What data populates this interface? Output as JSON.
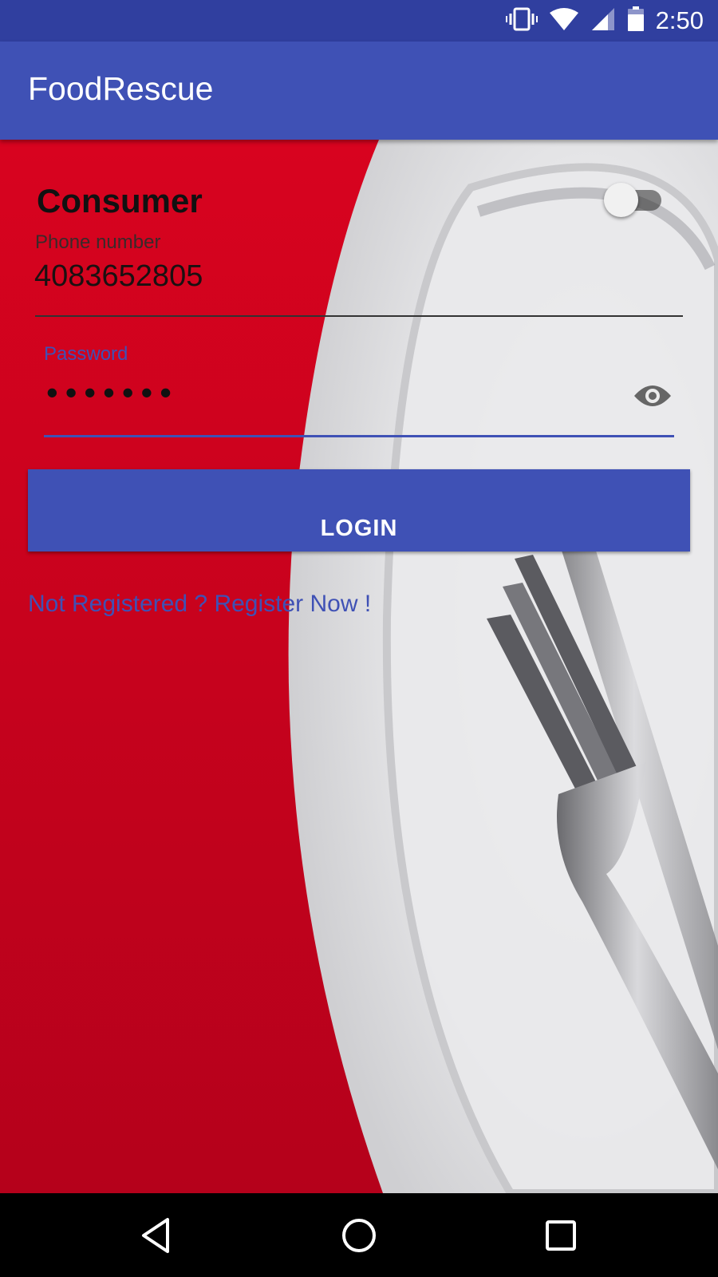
{
  "status_bar": {
    "time": "2:50",
    "icons": [
      "vibrate-icon",
      "wifi-icon",
      "signal-icon",
      "battery-icon"
    ]
  },
  "app_bar": {
    "title": "FoodRescue"
  },
  "login_form": {
    "mode_label": "Consumer",
    "mode_switch_on": false,
    "phone": {
      "hint": "Phone number",
      "value": "4083652805"
    },
    "password": {
      "hint": "Password",
      "masked_value": "•••••••",
      "toggle_icon": "eye-icon"
    },
    "login_label": "LOGIN",
    "register_link": "Not Registered ? Register Now !"
  },
  "nav_bar": {
    "icons": [
      "back-icon",
      "home-icon",
      "recents-icon"
    ]
  },
  "colors": {
    "primary": "#3F51B5",
    "primary_dark": "#303F9F",
    "background_red": "#d0021b"
  }
}
